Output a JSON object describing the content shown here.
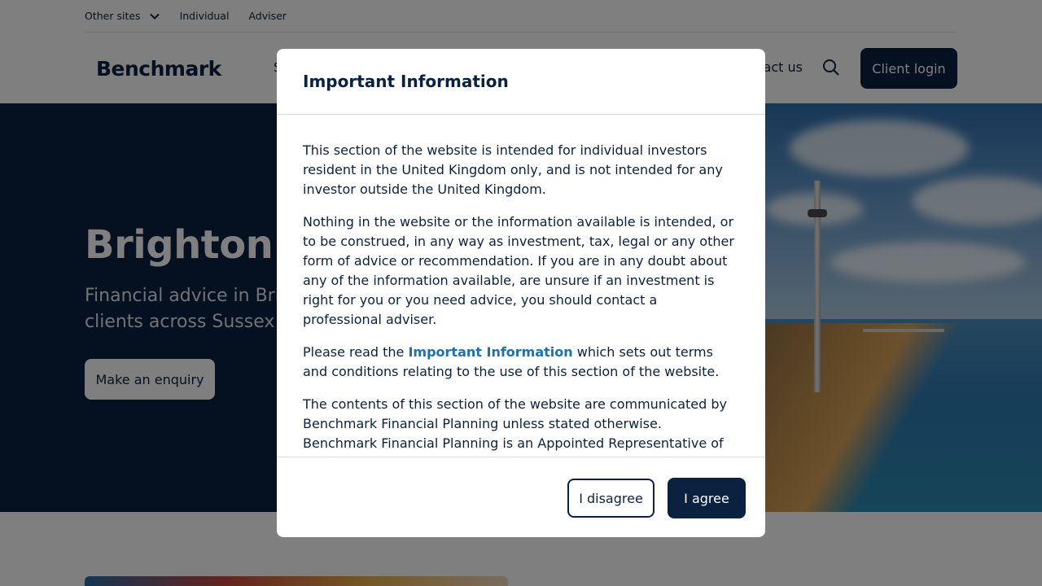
{
  "utility_bar": {
    "other_sites_label": "Other sites",
    "individual_label": "Individual",
    "adviser_label": "Adviser"
  },
  "nav": {
    "logo_text": "Benchmark",
    "partial_item": "S",
    "contact_label": "act us",
    "client_login_label": "Client login"
  },
  "hero": {
    "title": "Brighton",
    "subtitle_line1": "Financial advice in Brig",
    "subtitle_line2": "clients across Sussex ar",
    "enquiry_label": "Make an enquiry"
  },
  "modal": {
    "title": "Important Information",
    "paragraph1": "This section of the website is intended for individual investors resident in the United Kingdom only, and is not intended for any investor outside the United Kingdom.",
    "paragraph2": "Nothing in the website or the information available is intended, or to be construed, in any way as investment, tax, legal or any other form of advice or recommendation. If you are in any doubt about any of the information available, are unsure if an investment is right for you or you need advice, you should contact a professional adviser.",
    "paragraph3_before": "Please read the ",
    "paragraph3_link": "Important Information",
    "paragraph3_after": " which sets out terms and conditions relating to the use of this section of the website.",
    "paragraph4": "The contents of this section of the website are communicated by Benchmark Financial Planning unless stated otherwise. Benchmark Financial Planning is an Appointed Representative of Best Practice IFA Group Limited which is authorised and regulated by the Financial",
    "disagree_label": "I disagree",
    "agree_label": "I agree"
  },
  "colors": {
    "brand_navy": "#0b2140",
    "link_blue": "#1a72b6",
    "overlay": "rgba(0,0,0,0.5)"
  }
}
